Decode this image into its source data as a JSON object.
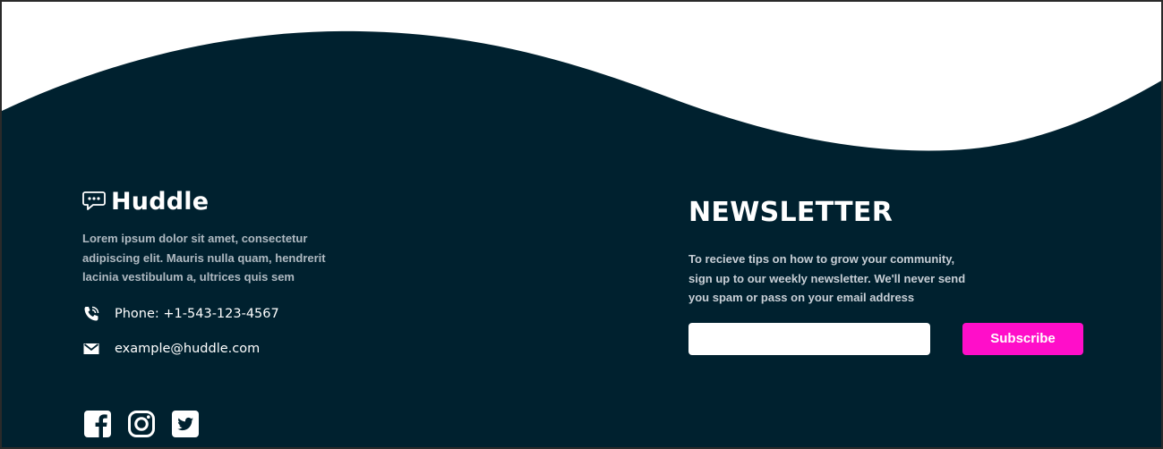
{
  "colors": {
    "footer_bg": "#00212f",
    "accent": "#ff0ec9",
    "text_light": "#c8cfd6",
    "white": "#ffffff"
  },
  "brand": {
    "logo_icon": "chat-bubble-icon",
    "name": "Huddle"
  },
  "about": {
    "text": "Lorem ipsum dolor sit amet, consectetur adipiscing elit. Mauris nulla quam, hendrerit lacinia vestibulum a, ultrices quis sem"
  },
  "contact": {
    "phone": {
      "icon": "phone-icon",
      "label": "Phone: +1-543-123-4567"
    },
    "email": {
      "icon": "mail-icon",
      "label": "example@huddle.com"
    }
  },
  "socials": [
    {
      "name": "facebook-icon"
    },
    {
      "name": "instagram-icon"
    },
    {
      "name": "twitter-icon"
    }
  ],
  "newsletter": {
    "title": "NEWSLETTER",
    "description": "To recieve tips on how to grow your community, sign up to our weekly newsletter. We'll never send you spam or pass on your email address",
    "input_value": "",
    "button_label": "Subscribe"
  }
}
